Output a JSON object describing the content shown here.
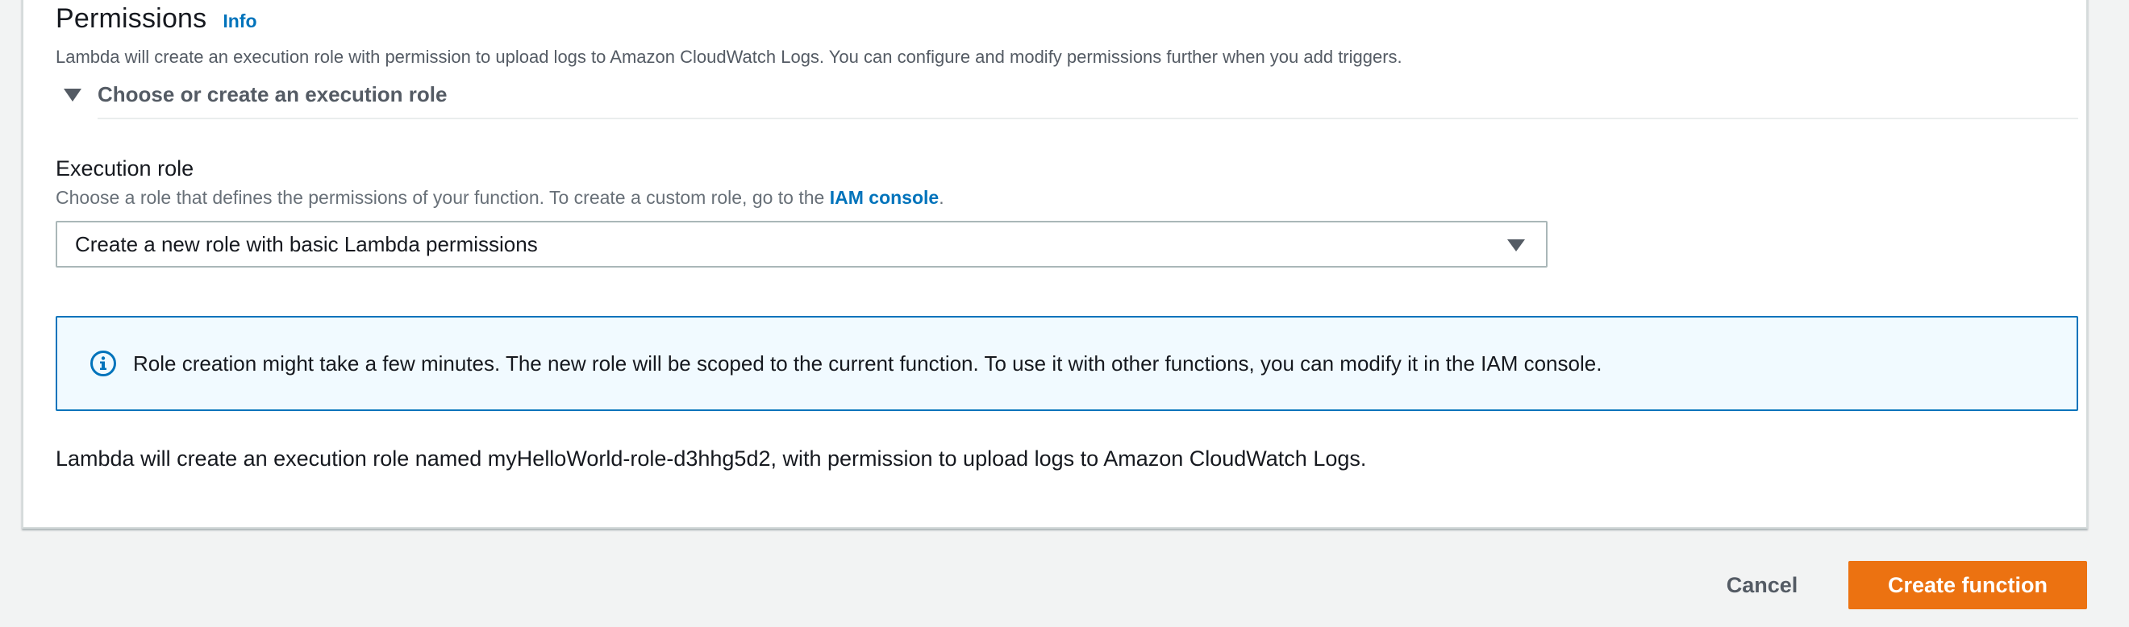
{
  "permissions": {
    "title": "Permissions",
    "info_link": "Info",
    "description": "Lambda will create an execution role with permission to upload logs to Amazon CloudWatch Logs. You can configure and modify permissions further when you add triggers.",
    "expander_label": "Choose or create an execution role"
  },
  "execution_role": {
    "label": "Execution role",
    "description_prefix": "Choose a role that defines the permissions of your function. To create a custom role, go to the ",
    "iam_link": "IAM console",
    "description_suffix": ".",
    "selected_value": "Create a new role with basic Lambda permissions"
  },
  "alert": {
    "icon": "info-circle-icon",
    "text": "Role creation might take a few minutes. The new role will be scoped to the current function. To use it with other functions, you can modify it in the IAM console."
  },
  "footnote": "Lambda will create an execution role named myHelloWorld-role-d3hhg5d2, with permission to upload logs to Amazon CloudWatch Logs.",
  "actions": {
    "cancel_label": "Cancel",
    "create_label": "Create function"
  },
  "colors": {
    "link": "#0073bb",
    "primary_button": "#ec7211",
    "alert_background": "#f1faff",
    "alert_border": "#0073bb",
    "page_background": "#f2f3f3"
  }
}
